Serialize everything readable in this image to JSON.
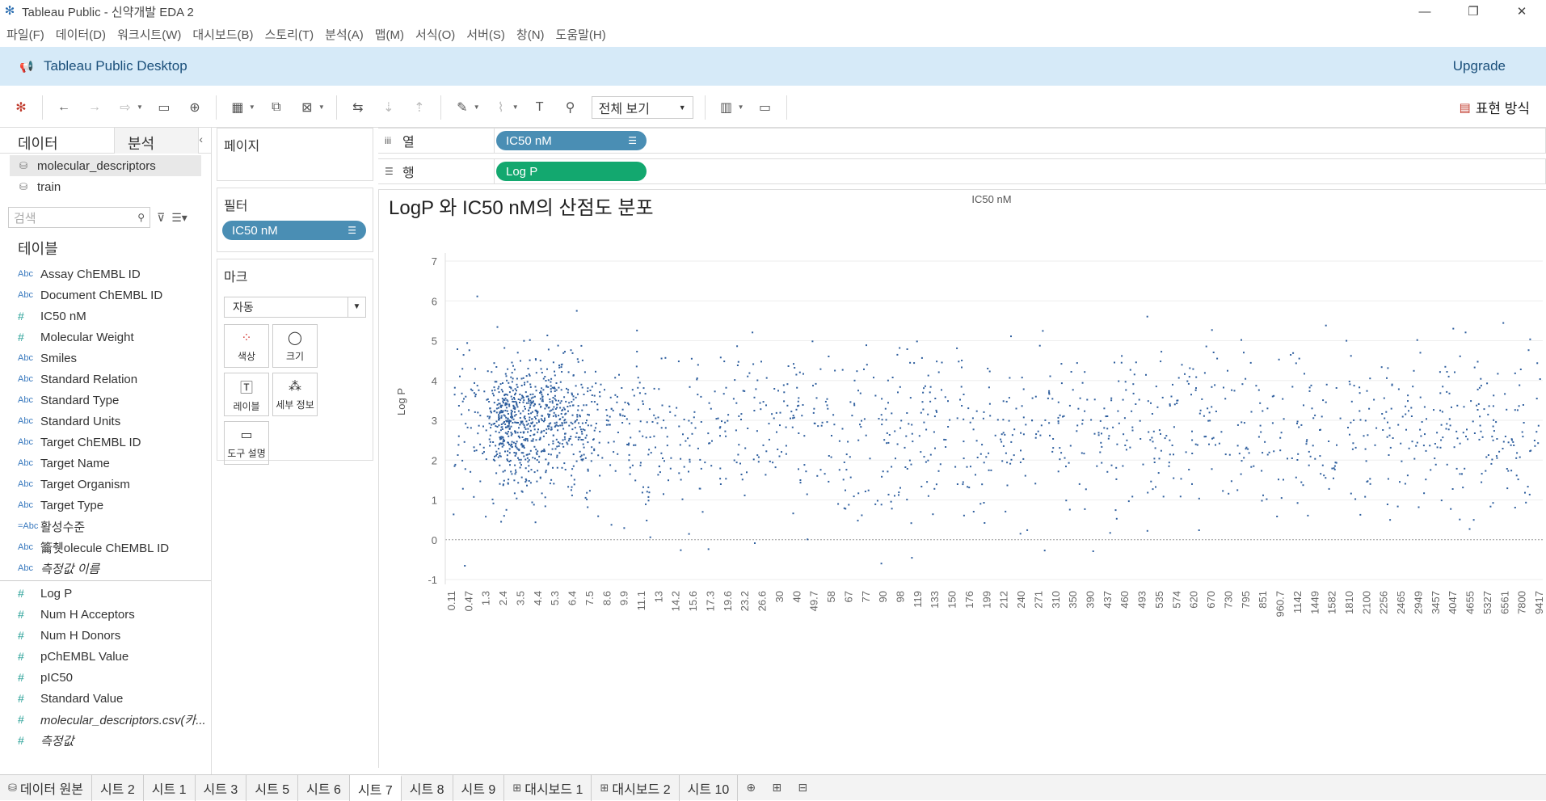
{
  "window": {
    "title": "Tableau Public - 신약개발 EDA 2"
  },
  "menu": [
    "파일(F)",
    "데이터(D)",
    "워크시트(W)",
    "대시보드(B)",
    "스토리(T)",
    "분석(A)",
    "맵(M)",
    "서식(O)",
    "서버(S)",
    "창(N)",
    "도움말(H)"
  ],
  "banner": {
    "title": "Tableau Public Desktop",
    "upgrade": "Upgrade"
  },
  "toolbar": {
    "fit": "전체 보기",
    "showme": "표현 방식"
  },
  "leftpanel": {
    "tab_data": "데이터",
    "tab_analysis": "분석",
    "datasources": [
      "molecular_descriptors",
      "train"
    ],
    "search_placeholder": "검색",
    "tables_header": "테이블",
    "dim_fields": [
      {
        "type": "Abc",
        "name": "Assay ChEMBL ID"
      },
      {
        "type": "Abc",
        "name": "Document ChEMBL ID"
      },
      {
        "type": "#",
        "name": "IC50 nM"
      },
      {
        "type": "#",
        "name": "Molecular Weight"
      },
      {
        "type": "Abc",
        "name": "Smiles"
      },
      {
        "type": "Abc",
        "name": "Standard Relation"
      },
      {
        "type": "Abc",
        "name": "Standard Type"
      },
      {
        "type": "Abc",
        "name": "Standard Units"
      },
      {
        "type": "Abc",
        "name": "Target ChEMBL ID"
      },
      {
        "type": "Abc",
        "name": "Target Name"
      },
      {
        "type": "Abc",
        "name": "Target Organism"
      },
      {
        "type": "Abc",
        "name": "Target Type"
      },
      {
        "type": "=Abc",
        "name": "활성수준"
      },
      {
        "type": "Abc",
        "name": "籥췟olecule ChEMBL ID"
      },
      {
        "type": "Abc",
        "name": "측정값 이름",
        "italic": true
      }
    ],
    "measure_fields": [
      {
        "type": "#",
        "name": "Log P"
      },
      {
        "type": "#",
        "name": "Num H Acceptors"
      },
      {
        "type": "#",
        "name": "Num H Donors"
      },
      {
        "type": "#",
        "name": "pChEMBL Value"
      },
      {
        "type": "#",
        "name": "pIC50"
      },
      {
        "type": "#",
        "name": "Standard Value"
      },
      {
        "type": "#",
        "name": "molecular_descriptors.csv(카...",
        "italic": true
      },
      {
        "type": "#",
        "name": "측정값",
        "italic": true
      }
    ]
  },
  "cards": {
    "pages": "페이지",
    "filters": "필터",
    "filter_pill": "IC50 nM",
    "marks": "마크",
    "mark_type": "자동",
    "mark_buttons": [
      "색상",
      "크기",
      "레이블",
      "세부 정보",
      "도구 설명"
    ]
  },
  "shelves": {
    "columns_label": "열",
    "columns_pill": "IC50 nM",
    "rows_label": "행",
    "rows_pill": "Log P"
  },
  "chart_data": {
    "type": "scatter",
    "title": "LogP 와 IC50 nM의 산점도 분포",
    "xlabel": "IC50 nM",
    "ylabel": "Log P",
    "ylim": [
      -1,
      7
    ],
    "yticks": [
      -1,
      0,
      1,
      2,
      3,
      4,
      5,
      6,
      7
    ],
    "x_categorical_ticks": [
      "0.11",
      "0.47",
      "1.3",
      "2.4",
      "3.5",
      "4.4",
      "5.3",
      "6.4",
      "7.5",
      "8.6",
      "9.9",
      "11.1",
      "13",
      "14.2",
      "15.6",
      "17.3",
      "19.6",
      "23.2",
      "26.6",
      "30",
      "40",
      "49.7",
      "58",
      "67",
      "77",
      "90",
      "98",
      "119",
      "133",
      "150",
      "176",
      "199",
      "212",
      "240",
      "271",
      "310",
      "350",
      "390",
      "437",
      "460",
      "493",
      "535",
      "574",
      "620",
      "670",
      "730",
      "795",
      "851",
      "960.7",
      "1142",
      "1449",
      "1582",
      "1810",
      "2100",
      "2256",
      "2465",
      "2949",
      "3457",
      "4047",
      "4655",
      "5327",
      "6561",
      "7800",
      "9417"
    ],
    "grid": true,
    "marker_color": "#2f5f9e",
    "point_count_approx": 2000,
    "note_density": "dense cluster of points around LogP 2-4 at low IC50 values, spread evenly elsewhere"
  },
  "tabs": [
    "데이터 원본",
    "시트 2",
    "시트 1",
    "시트 3",
    "시트 5",
    "시트 6",
    "시트 7",
    "시트 8",
    "시트 9",
    "대시보드 1",
    "대시보드 2",
    "시트 10"
  ],
  "active_tab": "시트 7"
}
